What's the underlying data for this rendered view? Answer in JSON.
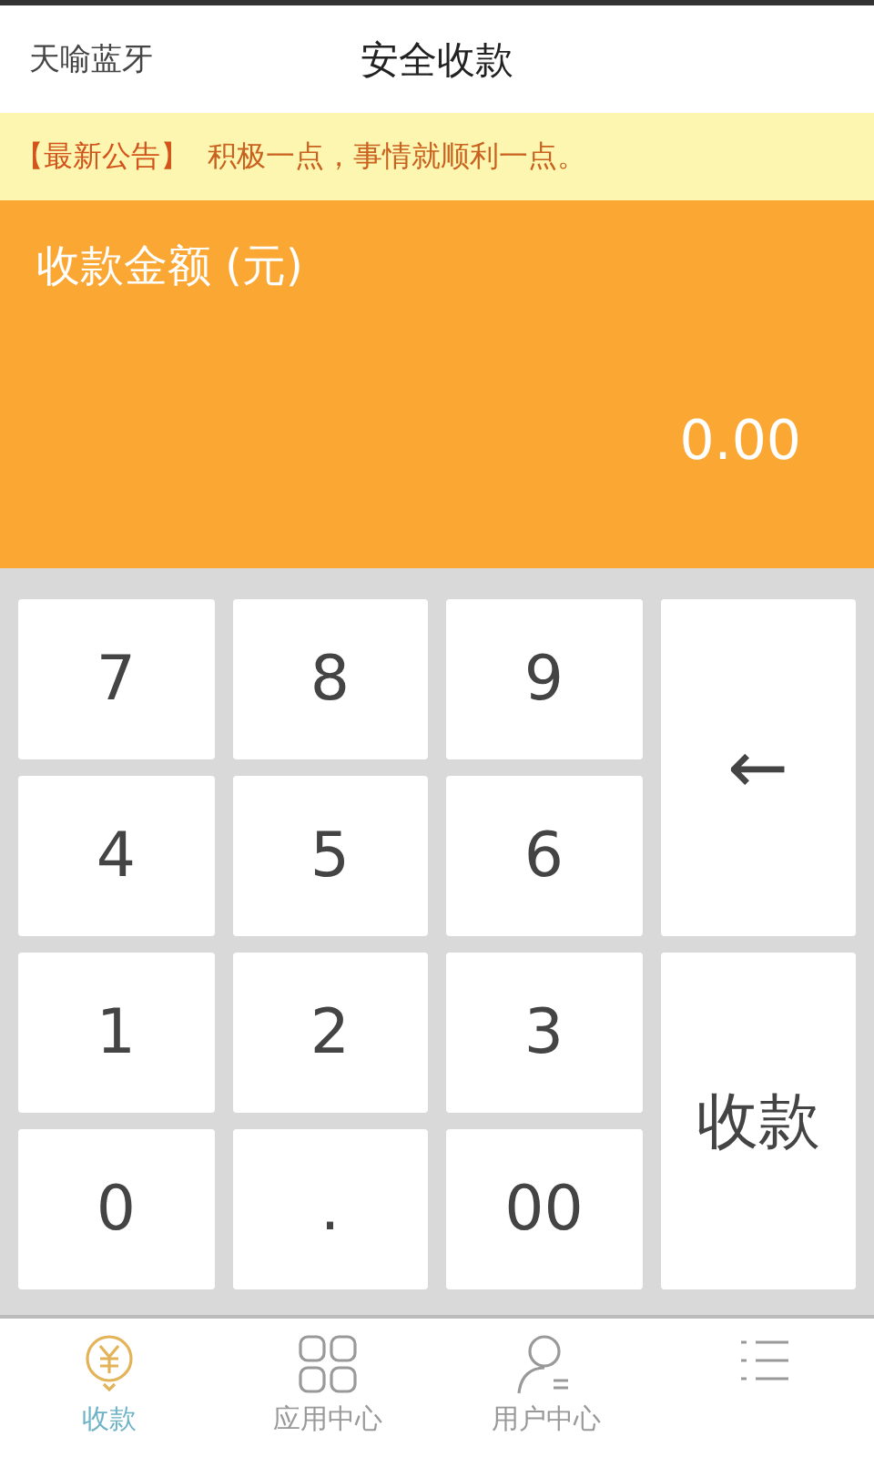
{
  "header": {
    "left": "天喻蓝牙",
    "title": "安全收款"
  },
  "notice": {
    "tag": "【最新公告】",
    "text": "积极一点，事情就顺利一点。"
  },
  "amount": {
    "label": "收款金额 (元)",
    "value": "0.00"
  },
  "keys": [
    {
      "label": "7",
      "kind": "digit"
    },
    {
      "label": "8",
      "kind": "digit"
    },
    {
      "label": "9",
      "kind": "digit"
    },
    {
      "label": "4",
      "kind": "digit"
    },
    {
      "label": "5",
      "kind": "digit"
    },
    {
      "label": "6",
      "kind": "digit"
    },
    {
      "label": "1",
      "kind": "digit"
    },
    {
      "label": "2",
      "kind": "digit"
    },
    {
      "label": "3",
      "kind": "digit"
    },
    {
      "label": "0",
      "kind": "digit"
    },
    {
      "label": ".",
      "kind": "digit"
    },
    {
      "label": "00",
      "kind": "digit"
    },
    {
      "label": "←",
      "kind": "backspace"
    },
    {
      "label": "收款",
      "kind": "submit"
    }
  ],
  "tabs": [
    {
      "label": "收款",
      "kind": "coin",
      "selected": true
    },
    {
      "label": "应用中心",
      "kind": "grid",
      "selected": false
    },
    {
      "label": "用户中心",
      "kind": "user",
      "selected": false
    },
    {
      "kind": "list",
      "selected": false
    }
  ]
}
